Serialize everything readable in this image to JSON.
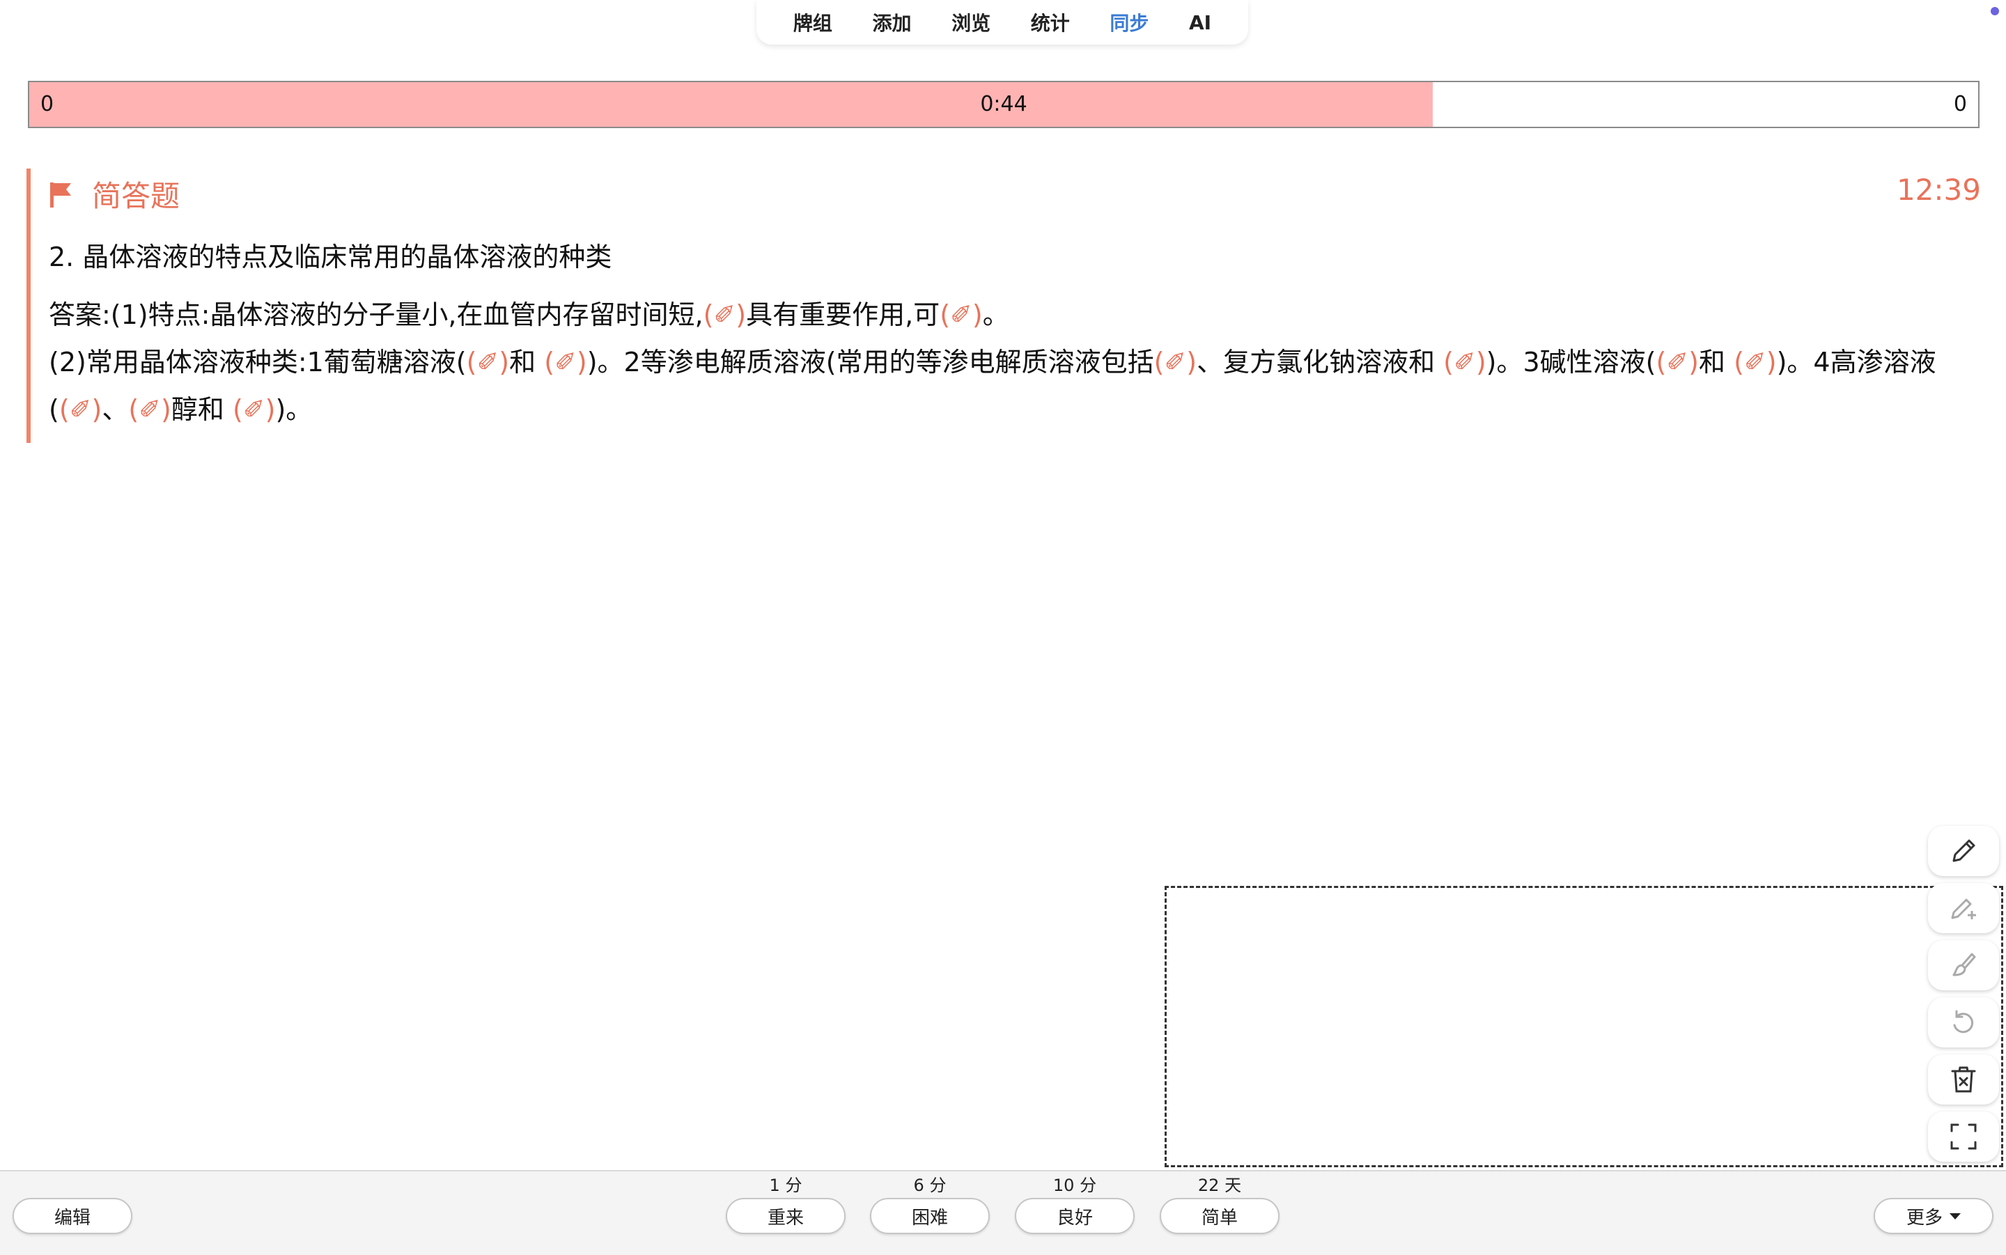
{
  "top_tabs": [
    "牌组",
    "添加",
    "浏览",
    "统计",
    "同步",
    "AI"
  ],
  "active_tab_index": 4,
  "timer_bar": {
    "left_value": "0",
    "center_value": "0:44",
    "right_value": "0",
    "fill_fraction": 0.72
  },
  "card": {
    "type_label": "简答题",
    "elapsed_time": "12:39",
    "question": "2. 晶体溶液的特点及临床常用的晶体溶液的种类",
    "answer_line1": [
      {
        "text": "答案:(1)特点:晶体溶液的分子量小,在血管内存留时间短,"
      },
      {
        "text": "(✐)",
        "cloze": true
      },
      {
        "text": "具有重要作用,可"
      },
      {
        "text": "(✐)",
        "cloze": true
      },
      {
        "text": "。"
      }
    ],
    "answer_line2": [
      {
        "text": "(2)常用晶体溶液种类:1葡萄糖溶液("
      },
      {
        "text": "(✐)",
        "cloze": true
      },
      {
        "text": "和 "
      },
      {
        "text": "(✐)",
        "cloze": true
      },
      {
        "text": ")。2等渗电解质溶液(常用的等渗电解质溶液包括"
      },
      {
        "text": "(✐)",
        "cloze": true
      },
      {
        "text": "、复方氯化钠溶液和 "
      },
      {
        "text": "(✐)",
        "cloze": true
      },
      {
        "text": ")。3碱性溶液("
      },
      {
        "text": "(✐)",
        "cloze": true
      },
      {
        "text": "和 "
      },
      {
        "text": "(✐)",
        "cloze": true
      },
      {
        "text": ")。4高渗溶液("
      },
      {
        "text": "(✐)",
        "cloze": true
      },
      {
        "text": "、"
      },
      {
        "text": "(✐)",
        "cloze": true
      },
      {
        "text": "醇和 "
      },
      {
        "text": "(✐)",
        "cloze": true
      },
      {
        "text": ")。"
      }
    ]
  },
  "colors": {
    "accent": "#e8735a",
    "active_tab": "#3a7bd5",
    "timer_fill": "#ffb3b3"
  },
  "draw_tools": [
    "pencil-icon",
    "pencil-plus-icon",
    "brush-icon",
    "undo-icon",
    "trash-icon",
    "fullscreen-icon"
  ],
  "bottom": {
    "edit_label": "编辑",
    "ease_buttons": [
      {
        "interval": "1 分",
        "label": "重来"
      },
      {
        "interval": "6 分",
        "label": "困难"
      },
      {
        "interval": "10 分",
        "label": "良好"
      },
      {
        "interval": "22 天",
        "label": "简单"
      }
    ],
    "more_label": "更多"
  }
}
